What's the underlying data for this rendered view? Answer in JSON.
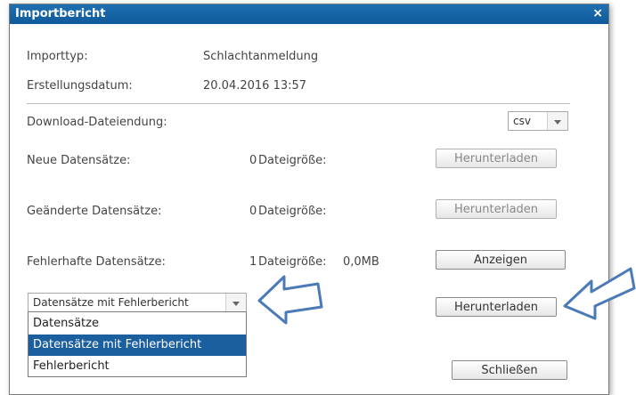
{
  "dialog": {
    "title": "Importbericht",
    "close_glyph": "×"
  },
  "info": {
    "import_type_label": "Importtyp:",
    "import_type_value": "Schlachtanmeldung",
    "created_label": "Erstellungsdatum:",
    "created_value": "20.04.2016 13:57"
  },
  "download_ext": {
    "label": "Download-Dateiendung:",
    "value": "csv"
  },
  "rows": {
    "new": {
      "label": "Neue Datensätze:",
      "count": "0",
      "size_label": "Dateigröße:",
      "size_value": "",
      "button": "Herunterladen"
    },
    "changed": {
      "label": "Geänderte Datensätze:",
      "count": "0",
      "size_label": "Dateigröße:",
      "size_value": "",
      "button": "Herunterladen"
    },
    "error": {
      "label": "Fehlerhafte Datensätze:",
      "count": "1",
      "size_label": "Dateigröße:",
      "size_value": "0,0MB",
      "button": "Anzeigen"
    }
  },
  "error_download": {
    "select_value": "Datensätze mit Fehlerbericht",
    "options": [
      "Datensätze",
      "Datensätze mit Fehlerbericht",
      "Fehlerbericht"
    ],
    "selected_index": 1,
    "button": "Herunterladen"
  },
  "footer": {
    "close_button": "Schließen"
  },
  "colors": {
    "title_bar": "#1565a8",
    "selected_option": "#1c5f9e",
    "annotation_arrow": "#4a7ab8"
  }
}
